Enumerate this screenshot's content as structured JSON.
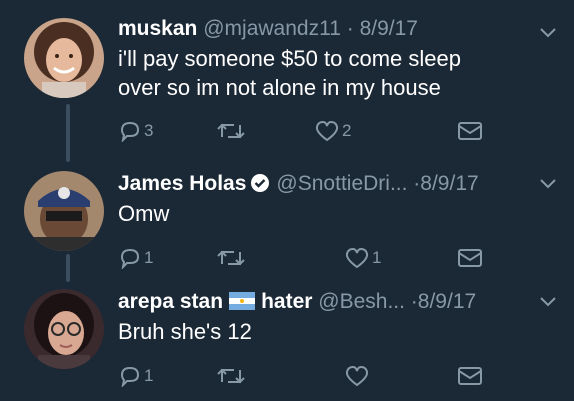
{
  "tweets": [
    {
      "name": "muskan",
      "handle": "@mjawandz11",
      "date": "8/9/17",
      "text_lines": [
        "i'll pay someone $50 to come sleep",
        "over so im not alone in my house"
      ],
      "reply_count": "3",
      "retweet_count": "",
      "like_count": "2"
    },
    {
      "name": "James Holas",
      "handle": "@SnottieDri...",
      "date": "8/9/17",
      "text_lines": [
        "Omw"
      ],
      "reply_count": "1",
      "retweet_count": "",
      "like_count": "1"
    },
    {
      "name": "arepa stan",
      "name_suffix": "hater",
      "handle": "@Besh...",
      "date": "8/9/17",
      "text_lines": [
        "Bruh she's 12"
      ],
      "reply_count": "1",
      "retweet_count": "",
      "like_count": ""
    }
  ],
  "separator": "·",
  "colors": {
    "background": "#1b2836",
    "muted": "#8899a6",
    "thread_line": "#3b4e60",
    "verified": "#ffffff"
  },
  "icons": {
    "reply": "reply-icon",
    "retweet": "retweet-icon",
    "like": "heart-icon",
    "dm": "envelope-icon",
    "menu": "chevron-down-icon",
    "verified": "verified-badge-icon",
    "flag": "argentina-flag-icon"
  }
}
